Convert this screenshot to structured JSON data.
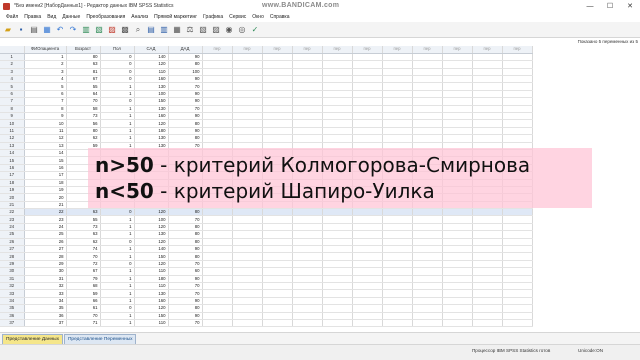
{
  "window": {
    "title": "*Без имени2 [НаборДанных1] - Редактор данных IBM SPSS Statistics",
    "watermark": "www.BANDICAM.com",
    "controls": [
      "—",
      "☐",
      "✕"
    ]
  },
  "menu": [
    "Файл",
    "Правка",
    "Вид",
    "Данные",
    "Преобразования",
    "Анализ",
    "Прямой маркетинг",
    "Графика",
    "Сервис",
    "Окно",
    "Справка"
  ],
  "toolbar_icons": [
    "open-file-icon",
    "save-icon",
    "print-icon",
    "recall-dialog-icon",
    "undo-icon",
    "redo-icon",
    "goto-case-icon",
    "goto-variable-icon",
    "variables-icon",
    "run-descriptives-icon",
    "find-icon",
    "insert-cases-icon",
    "insert-variable-icon",
    "split-file-icon",
    "weight-cases-icon",
    "select-cases-icon",
    "value-labels-icon",
    "use-sets-icon",
    "show-all-icon",
    "spelling-icon"
  ],
  "shown_variables": "Показано 5 переменных из 5",
  "columns": [
    "ФИОпациента",
    "Возраст",
    "Пол",
    "САД",
    "ДАД",
    "пер",
    "пер",
    "пер",
    "пер",
    "пер",
    "пер",
    "пер",
    "пер",
    "пер",
    "пер",
    "пер"
  ],
  "rows": [
    [
      "1",
      "80",
      "0",
      "140",
      "90"
    ],
    [
      "2",
      "63",
      "0",
      "120",
      "80"
    ],
    [
      "3",
      "81",
      "0",
      "110",
      "100"
    ],
    [
      "4",
      "67",
      "0",
      "160",
      "90"
    ],
    [
      "5",
      "55",
      "1",
      "130",
      "70"
    ],
    [
      "6",
      "64",
      "1",
      "100",
      "90"
    ],
    [
      "7",
      "70",
      "0",
      "150",
      "90"
    ],
    [
      "8",
      "58",
      "1",
      "130",
      "70"
    ],
    [
      "9",
      "73",
      "1",
      "160",
      "90"
    ],
    [
      "10",
      "56",
      "1",
      "120",
      "80"
    ],
    [
      "11",
      "80",
      "1",
      "180",
      "90"
    ],
    [
      "12",
      "62",
      "1",
      "130",
      "80"
    ],
    [
      "13",
      "59",
      "1",
      "130",
      "70"
    ],
    [
      "14",
      "",
      "",
      "",
      ""
    ],
    [
      "15",
      "",
      "",
      "",
      ""
    ],
    [
      "16",
      "",
      "",
      "",
      ""
    ],
    [
      "17",
      "",
      "",
      "",
      ""
    ],
    [
      "18",
      "",
      "",
      "",
      ""
    ],
    [
      "19",
      "",
      "",
      "",
      ""
    ],
    [
      "20",
      "",
      "",
      "",
      ""
    ],
    [
      "21",
      "",
      "",
      "",
      ""
    ],
    [
      "22",
      "63",
      "0",
      "120",
      "80"
    ],
    [
      "23",
      "55",
      "1",
      "100",
      "70"
    ],
    [
      "24",
      "73",
      "1",
      "120",
      "80"
    ],
    [
      "25",
      "63",
      "1",
      "130",
      "80"
    ],
    [
      "26",
      "62",
      "0",
      "120",
      "80"
    ],
    [
      "27",
      "74",
      "1",
      "140",
      "90"
    ],
    [
      "28",
      "70",
      "1",
      "150",
      "80"
    ],
    [
      "29",
      "72",
      "0",
      "120",
      "70"
    ],
    [
      "30",
      "67",
      "1",
      "110",
      "60"
    ],
    [
      "31",
      "79",
      "1",
      "180",
      "90"
    ],
    [
      "32",
      "68",
      "1",
      "110",
      "70"
    ],
    [
      "33",
      "59",
      "1",
      "130",
      "70"
    ],
    [
      "34",
      "66",
      "1",
      "160",
      "90"
    ],
    [
      "35",
      "61",
      "0",
      "120",
      "80"
    ],
    [
      "36",
      "70",
      "1",
      "150",
      "90"
    ],
    [
      "37",
      "71",
      "1",
      "110",
      "70"
    ]
  ],
  "selected_row": 22,
  "annotation": {
    "line1_bold": "n>50",
    "line1_text": " - критерий Колмогорова-Смирнова",
    "line2_bold": "n<50",
    "line2_text": " - критерий Шапиро-Уилка"
  },
  "tabs": [
    "Представление Данных",
    "Представление Переменных"
  ],
  "status": {
    "processor": "Процессор IBM SPSS Statistics готов",
    "unicode": "Unicode:ON"
  },
  "colors": {
    "highlight": "#ffc4d6",
    "active_tab": "#f5e68a",
    "header_bg": "#eef2f7"
  }
}
